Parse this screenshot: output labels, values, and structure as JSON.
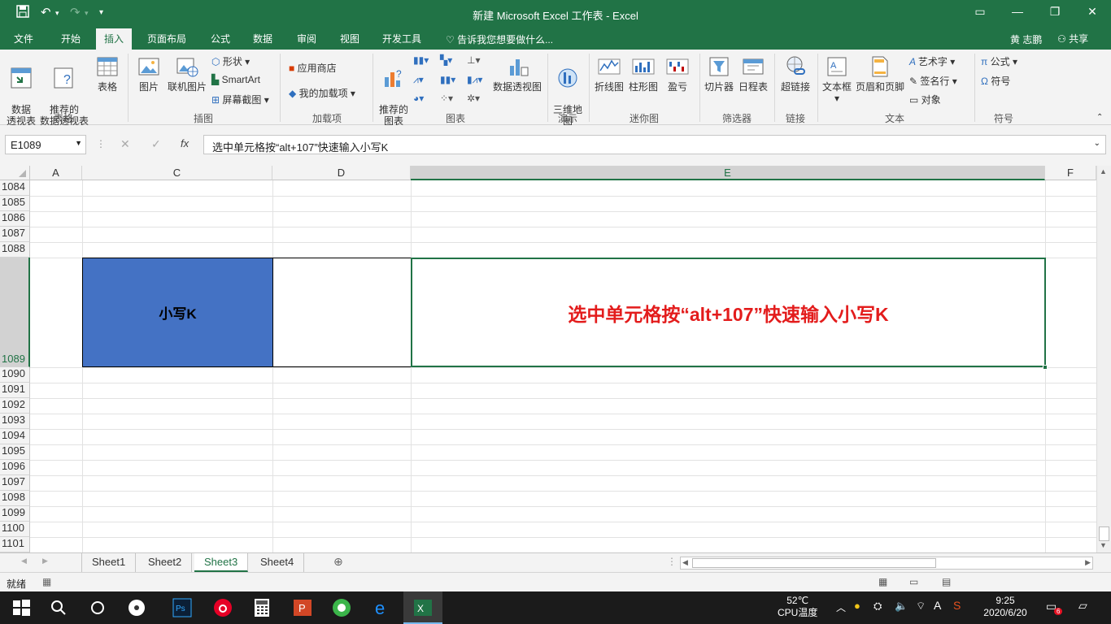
{
  "titlebar": {
    "title": "新建 Microsoft Excel 工作表 - Excel"
  },
  "tabs": [
    "文件",
    "开始",
    "插入",
    "页面布局",
    "公式",
    "数据",
    "审阅",
    "视图",
    "开发工具"
  ],
  "tellme": "告诉我您想要做什么...",
  "user": {
    "name": "黄 志鹏",
    "share": "共享"
  },
  "ribbon": {
    "pivot": "数据\n透视表",
    "rec_pivot": "推荐的\n数据透视表",
    "table": "表格",
    "group_tables": "表格",
    "picture": "图片",
    "online_picture": "联机图片",
    "shapes": "形状",
    "smartart": "SmartArt",
    "screenshot": "屏幕截图",
    "group_illustrations": "插图",
    "store": "应用商店",
    "my_addins": "我的加载项",
    "group_addins": "加载项",
    "rec_charts": "推荐的\n图表",
    "pivot_chart": "数据透视图",
    "group_charts": "图表",
    "map3d": "三维地\n图",
    "group_tours": "演示",
    "line": "折线图",
    "column": "柱形图",
    "winloss": "盈亏",
    "group_sparklines": "迷你图",
    "slicer": "切片器",
    "timeline": "日程表",
    "group_filters": "筛选器",
    "hyperlink": "超链接",
    "group_links": "链接",
    "textbox": "文本框",
    "header_footer": "页眉和页脚",
    "wordart": "艺术字",
    "signature": "签名行",
    "object": "对象",
    "group_text": "文本",
    "equation": "公式",
    "symbol": "符号",
    "group_symbols": "符号"
  },
  "formula": {
    "namebox": "E1089",
    "content": "选中单元格按“alt+107”快速输入小写K"
  },
  "columns": [
    "A",
    "C",
    "D",
    "E",
    "F"
  ],
  "rows": [
    "1084",
    "1085",
    "1086",
    "1087",
    "1088",
    "1089",
    "1090",
    "1091",
    "1092",
    "1093",
    "1094",
    "1095",
    "1096",
    "1097",
    "1098",
    "1099",
    "1100",
    "1101"
  ],
  "cells": {
    "c1089": "小写K",
    "e1089": "选中单元格按“alt+107”快速输入小写K"
  },
  "sheets": [
    "Sheet1",
    "Sheet2",
    "Sheet3",
    "Sheet4"
  ],
  "active_sheet": "Sheet3",
  "status": {
    "ready": "就绪"
  },
  "taskbar": {
    "temp": "52℃",
    "temp_label": "CPU温度",
    "time": "9:25",
    "date": "2020/6/20",
    "notif_count": "6"
  },
  "colors": {
    "excel_green": "#217346",
    "cell_blue": "#4472C4",
    "red_text": "#E31C1C"
  }
}
